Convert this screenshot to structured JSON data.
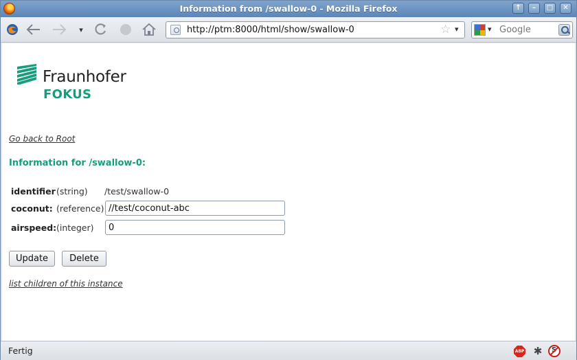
{
  "window": {
    "title": "Information from /swallow-0 - Mozilla Firefox",
    "controls": [
      "↑",
      "–",
      "□",
      "✕"
    ]
  },
  "nav": {
    "url": "http://ptm:8000/html/show/swallow-0",
    "search_placeholder": "Google",
    "icons": [
      "firefox-logo-icon",
      "back-icon",
      "forward-icon",
      "history-dropdown-icon",
      "reload-icon",
      "stop-icon",
      "home-icon"
    ]
  },
  "page": {
    "logo_text": "Fraunhofer",
    "logo_sub": "FOKUS",
    "back_link": "Go back to Root",
    "heading": "Information for /swallow-0:",
    "rows": [
      {
        "label": "identifier",
        "type": "(string)",
        "value": "/test/swallow-0"
      },
      {
        "label": "coconut:",
        "type": "(reference)",
        "value": "//test/coconut-abc"
      },
      {
        "label": "airspeed:",
        "type": "(integer)",
        "value": "0"
      }
    ],
    "update_label": "Update",
    "delete_label": "Delete",
    "children_link": "list children of this instance"
  },
  "status": {
    "text": "Fertig",
    "abp_label": "ABP"
  },
  "colors": {
    "accent": "#179c7d",
    "titlebar": "#6d95c2"
  }
}
